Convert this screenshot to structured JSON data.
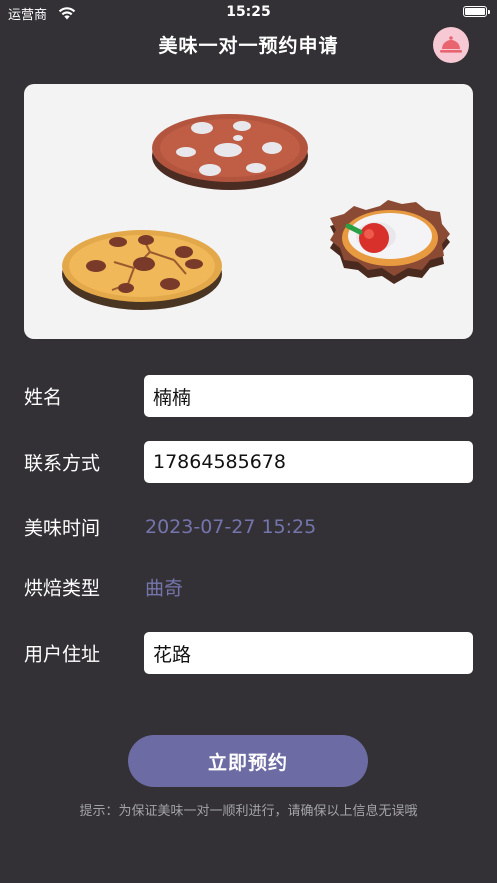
{
  "status_bar": {
    "carrier": "运营商",
    "time": "15:25"
  },
  "nav": {
    "title": "美味一对一预约申请",
    "icon": "cloche-icon"
  },
  "hero": {
    "image": "cookies-and-pizza-illustration"
  },
  "form": {
    "name": {
      "label": "姓名",
      "value": "楠楠"
    },
    "contact": {
      "label": "联系方式",
      "value": "17864585678"
    },
    "time": {
      "label": "美味时间",
      "value": "2023-07-27 15:25"
    },
    "bake_type": {
      "label": "烘焙类型",
      "value": "曲奇"
    },
    "address": {
      "label": "用户住址",
      "value": "花路"
    }
  },
  "submit": {
    "label": "立即预约"
  },
  "hint": "提示：为保证美味一对一顺利进行，请确保以上信息无误哦",
  "colors": {
    "background": "#333135",
    "accent": "#6d6ba4",
    "value_text": "#7575ad"
  }
}
